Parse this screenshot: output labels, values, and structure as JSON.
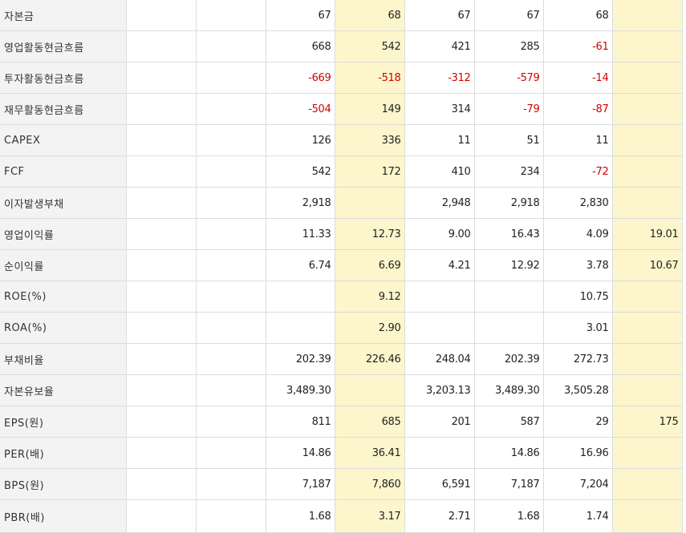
{
  "colors": {
    "label_bg": "#f3f3f3",
    "highlight_bg": "#fdf6cc",
    "negative_text": "#d40000",
    "grid_line": "#dcdcdc"
  },
  "rows": [
    {
      "label": "자본금",
      "values": [
        "",
        "",
        "67",
        "68",
        "67",
        "67",
        "68",
        ""
      ]
    },
    {
      "label": "영업활동현금흐름",
      "values": [
        "",
        "",
        "668",
        "542",
        "421",
        "285",
        "-61",
        ""
      ]
    },
    {
      "label": "투자활동현금흐름",
      "values": [
        "",
        "",
        "-669",
        "-518",
        "-312",
        "-579",
        "-14",
        ""
      ]
    },
    {
      "label": "재무활동현금흐름",
      "values": [
        "",
        "",
        "-504",
        "149",
        "314",
        "-79",
        "-87",
        ""
      ]
    },
    {
      "label": "CAPEX",
      "values": [
        "",
        "",
        "126",
        "336",
        "11",
        "51",
        "11",
        ""
      ]
    },
    {
      "label": "FCF",
      "values": [
        "",
        "",
        "542",
        "172",
        "410",
        "234",
        "-72",
        ""
      ]
    },
    {
      "label": "이자발생부채",
      "values": [
        "",
        "",
        "2,918",
        "",
        "2,948",
        "2,918",
        "2,830",
        ""
      ]
    },
    {
      "label": "영업이익률",
      "values": [
        "",
        "",
        "11.33",
        "12.73",
        "9.00",
        "16.43",
        "4.09",
        "19.01"
      ]
    },
    {
      "label": "순이익률",
      "values": [
        "",
        "",
        "6.74",
        "6.69",
        "4.21",
        "12.92",
        "3.78",
        "10.67"
      ]
    },
    {
      "label": "ROE(%)",
      "values": [
        "",
        "",
        "",
        "9.12",
        "",
        "",
        "10.75",
        ""
      ]
    },
    {
      "label": "ROA(%)",
      "values": [
        "",
        "",
        "",
        "2.90",
        "",
        "",
        "3.01",
        ""
      ]
    },
    {
      "label": "부채비율",
      "values": [
        "",
        "",
        "202.39",
        "226.46",
        "248.04",
        "202.39",
        "272.73",
        ""
      ]
    },
    {
      "label": "자본유보율",
      "values": [
        "",
        "",
        "3,489.30",
        "",
        "3,203.13",
        "3,489.30",
        "3,505.28",
        ""
      ]
    },
    {
      "label": "EPS(원)",
      "values": [
        "",
        "",
        "811",
        "685",
        "201",
        "587",
        "29",
        "175"
      ]
    },
    {
      "label": "PER(배)",
      "values": [
        "",
        "",
        "14.86",
        "36.41",
        "",
        "14.86",
        "16.96",
        ""
      ]
    },
    {
      "label": "BPS(원)",
      "values": [
        "",
        "",
        "7,187",
        "7,860",
        "6,591",
        "7,187",
        "7,204",
        ""
      ]
    },
    {
      "label": "PBR(배)",
      "values": [
        "",
        "",
        "1.68",
        "3.17",
        "2.71",
        "1.68",
        "1.74",
        ""
      ]
    }
  ]
}
